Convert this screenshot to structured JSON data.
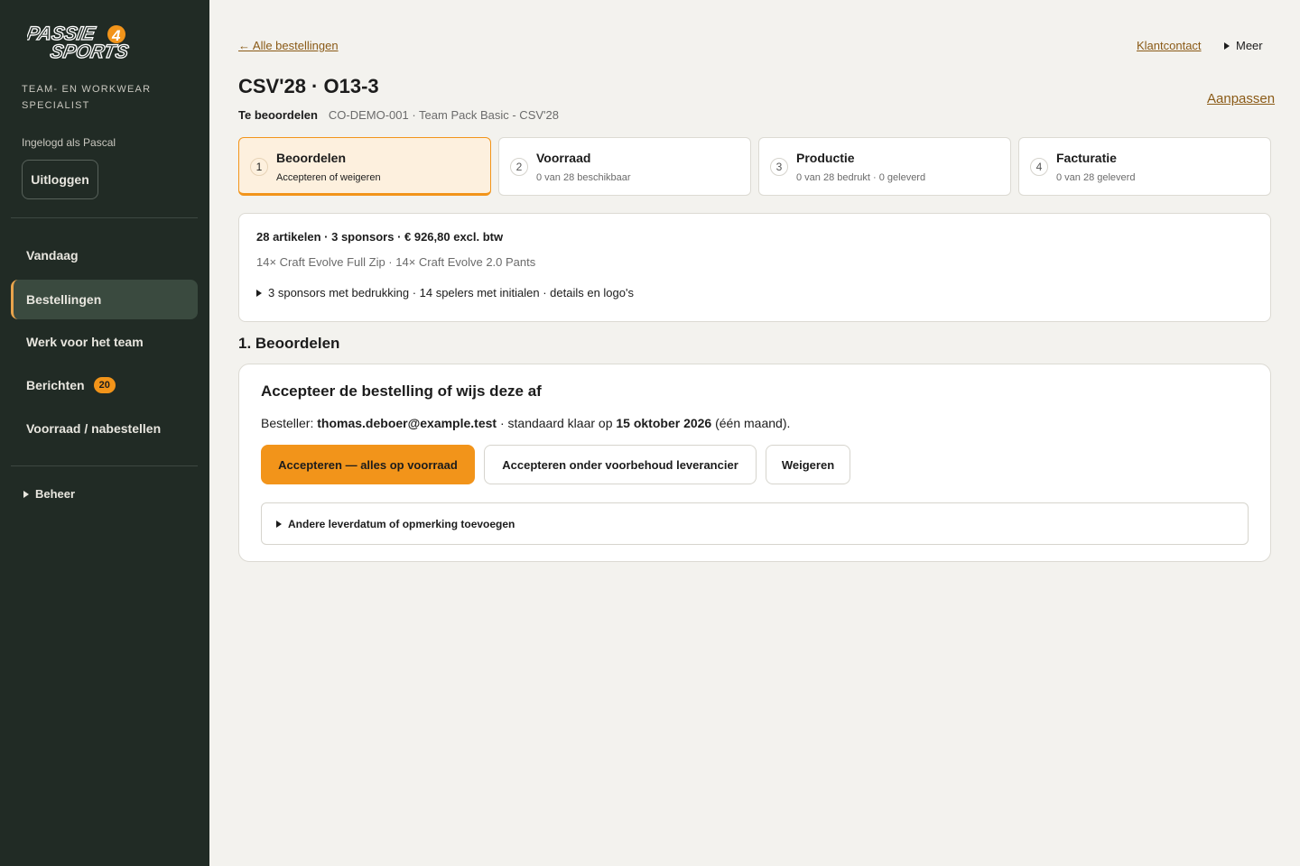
{
  "brand": {
    "logo_line1": "PASSIE",
    "logo_number": "4",
    "logo_line2": "SPORTS",
    "tagline": "TEAM- EN WORKWEAR SPECIALIST",
    "accent_color": "#f2941a",
    "sidebar_bg": "#212b25"
  },
  "user": {
    "logged_in_text": "Ingelogd als Pascal",
    "logout_label": "Uitloggen"
  },
  "nav": {
    "items": [
      {
        "label": "Vandaag"
      },
      {
        "label": "Bestellingen",
        "active": true
      },
      {
        "label": "Werk voor het team"
      },
      {
        "label": "Berichten",
        "badge": "20"
      },
      {
        "label": "Voorraad / nabestellen"
      }
    ],
    "beheer_label": "Beheer"
  },
  "header": {
    "back_link": "← Alle bestellingen",
    "contact_link": "Klantcontact",
    "more_label": "Meer",
    "title": "CSV'28 · O13-3",
    "edit_link": "Aanpassen",
    "status": "Te beoordelen",
    "meta": "CO-DEMO-001 · Team Pack Basic - CSV'28"
  },
  "steps": [
    {
      "num": "1",
      "title": "Beoordelen",
      "sub": "Accepteren of weigeren",
      "active": true
    },
    {
      "num": "2",
      "title": "Voorraad",
      "sub": "0 van 28 beschikbaar"
    },
    {
      "num": "3",
      "title": "Productie",
      "sub": "0 van 28 bedrukt · 0 geleverd"
    },
    {
      "num": "4",
      "title": "Facturatie",
      "sub": "0 van 28 geleverd"
    }
  ],
  "summary": {
    "headline": "28 artikelen · 3 sponsors · € 926,80 excl. btw",
    "items": "14× Craft Evolve Full Zip · 14× Craft Evolve 2.0 Pants",
    "details_toggle": "3 sponsors met bedrukking · 14 spelers met initialen · details en logo's"
  },
  "review": {
    "section_title": "1. Beoordelen",
    "card_title": "Accepteer de bestelling of wijs deze af",
    "orderer_label": "Besteller: ",
    "orderer_email": "thomas.deboer@example.test",
    "ready_text": " · standaard klaar op ",
    "ready_date": "15 oktober 2026",
    "ready_note": " (één maand).",
    "btn_accept_stock": "Accepteren — alles op voorraad",
    "btn_accept_supplier": "Accepteren onder voorbehoud leverancier",
    "btn_reject": "Weigeren",
    "extra_toggle": "Andere leverdatum of opmerking toevoegen"
  }
}
